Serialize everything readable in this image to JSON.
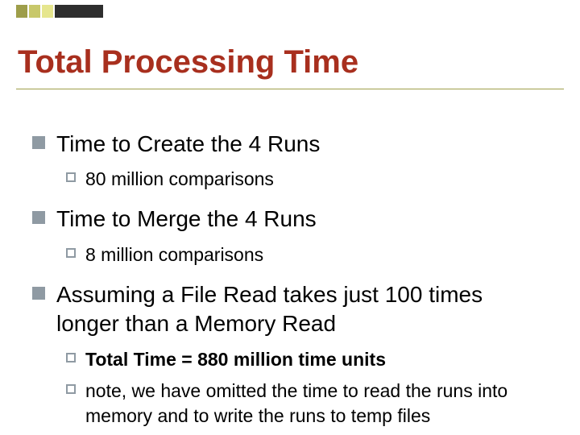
{
  "title": "Total Processing Time",
  "items": [
    {
      "text": "Time to Create the 4 Runs",
      "sub": [
        {
          "text": "80 million comparisons"
        }
      ]
    },
    {
      "text": "Time to Merge the 4 Runs",
      "sub": [
        {
          "text": "8 million comparisons"
        }
      ]
    },
    {
      "text": "Assuming a File Read takes just 100 times longer than a Memory Read",
      "sub": [
        {
          "text": "Total Time = 880 million time units",
          "bold": true
        },
        {
          "text": "note, we have omitted the time to read the runs into memory and to write the runs to temp files"
        }
      ]
    }
  ]
}
